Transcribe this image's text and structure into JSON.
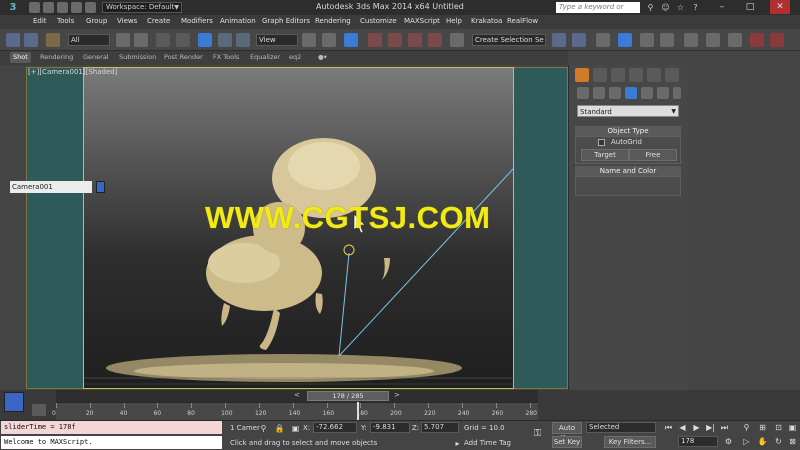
{
  "titlebar": {
    "logo": "3",
    "workspace": "Workspace: Default",
    "title": "Autodesk 3ds Max  2014 x64      Untitled",
    "search_placeholder": "Type a keyword or phrase",
    "minimize": "–",
    "maximize": "□",
    "close": "✕"
  },
  "menu": [
    "Edit",
    "Tools",
    "Group",
    "Views",
    "Create",
    "Modifiers",
    "Animation",
    "Graph Editors",
    "Rendering",
    "Customize",
    "MAXScript",
    "Help",
    "Krakatoa",
    "RealFlow"
  ],
  "toolbar": {
    "selection_filter": "All",
    "reference_coord": "View",
    "named_selection": "Create Selection Se"
  },
  "ribbon_tabs": [
    "Shot",
    "Rendering",
    "General",
    "Submission",
    "Post Render",
    "FX Tools",
    "Equalizer",
    "eq2"
  ],
  "viewport": {
    "label": "[+][Camera001][Shaded]",
    "watermark": "WWW.CGTSJ.COM"
  },
  "command_panel": {
    "category": "Standard",
    "object_type_title": "Object Type",
    "autogrid_label": "AutoGrid",
    "target_button": "Target",
    "free_button": "Free",
    "name_color_title": "Name and Color",
    "object_name": "Camera001",
    "swatch_color": "#3a66c8"
  },
  "timeline": {
    "slider_label": "178 / 285",
    "current_frame": 178,
    "total_frames": 285,
    "ticks": [
      "0",
      "20",
      "40",
      "60",
      "80",
      "100",
      "120",
      "140",
      "160",
      "180",
      "200",
      "220",
      "240",
      "260",
      "280"
    ]
  },
  "status": {
    "listener_text": "sliderTime = 178f",
    "output_text": "Welcome to MAXScript.",
    "selection_count": "1 Camer",
    "prompt": "Click and drag to select and move objects",
    "x_label": "X:",
    "x_value": "-72.662",
    "y_label": "Y:",
    "y_value": "-9.831",
    "z_label": "Z:",
    "z_value": "5.707",
    "grid": "Grid = 10.0",
    "add_time_tag": "Add Time Tag",
    "auto_key": "Auto Key",
    "set_key": "Set Key",
    "key_mode": "Selected",
    "key_filters": "Key Filters...",
    "frame_field": "178"
  }
}
